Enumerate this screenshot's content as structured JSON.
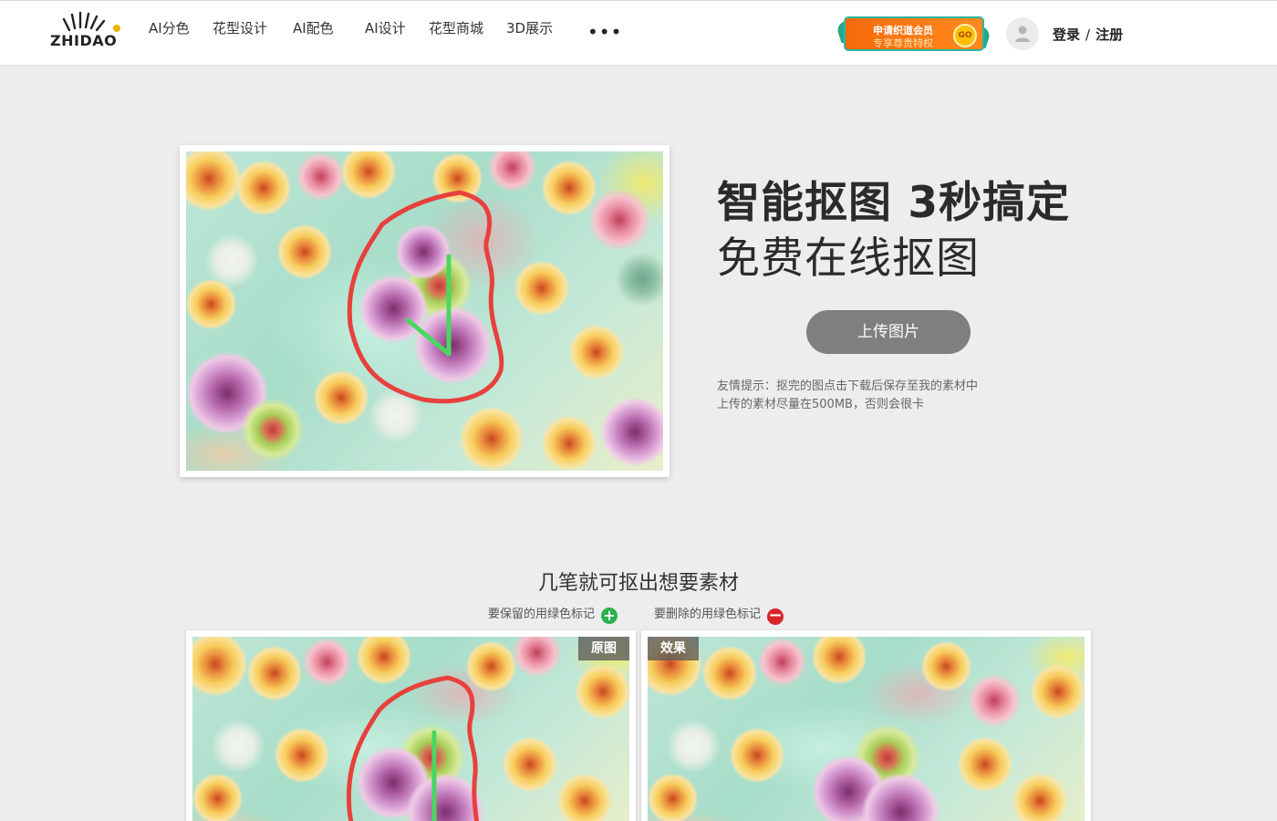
{
  "header": {
    "logo_text": "ZHIDAO",
    "nav": [
      {
        "label": "AI分色"
      },
      {
        "label": "花型设计"
      },
      {
        "label": "AI配色"
      },
      {
        "label": "AI设计"
      },
      {
        "label": "花型商城"
      },
      {
        "label": "3D展示"
      }
    ],
    "more_label": "•••",
    "vip": {
      "line1": "申请织道会员",
      "line2": "专享尊贵特权",
      "go": "GO"
    },
    "login": "登录",
    "separator": "/",
    "register": "注册"
  },
  "hero": {
    "title": "智能抠图 3秒搞定",
    "subtitle": "免费在线抠图",
    "upload_button": "上传图片",
    "tip_line1": "友情提示：抠完的图点击下载后保存至我的素材中",
    "tip_line2": "上传的素材尽量在500MB，否则会很卡"
  },
  "section": {
    "title": "几笔就可抠出想要素材",
    "legend_keep": "要保留的用绿色标记",
    "legend_delete": "要删除的用绿色标记",
    "tag_original": "原图",
    "tag_result": "效果"
  },
  "colors": {
    "accent_orange": "#f56a0a",
    "upload_button": "#7f7f7f",
    "marker_keep": "#2bb24c",
    "marker_delete": "#d9262b",
    "scribble_red": "#e8403c",
    "scribble_green": "#48d860"
  },
  "icons": [
    "logo-rays-icon",
    "user-avatar-icon",
    "plus-circle-icon",
    "minus-circle-icon"
  ]
}
